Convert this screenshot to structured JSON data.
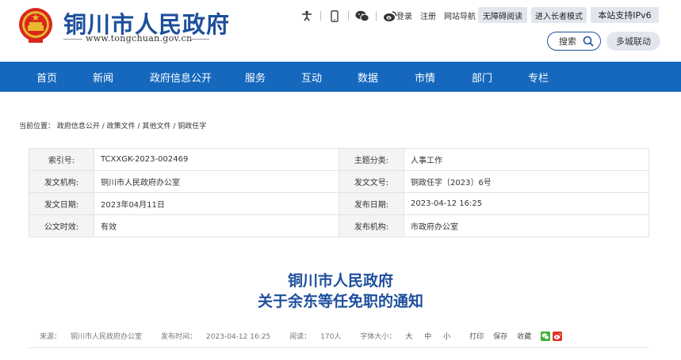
{
  "header": {
    "site_title": "铜川市人民政府",
    "site_url": "www.tongchuan.gov.cn",
    "top_links": {
      "login": "登录",
      "register": "注册",
      "sitemap": "网站导航"
    },
    "accessibility_button": "无障碍阅读",
    "elder_mode_button": "进入长者模式",
    "ipv6_button": "本站支持IPv6",
    "search_label": "搜索",
    "multi_city_button": "多城联动"
  },
  "nav": {
    "items": [
      "首页",
      "新闻",
      "政府信息公开",
      "服务",
      "互动",
      "数据",
      "市情",
      "部门",
      "专栏"
    ]
  },
  "breadcrumb": {
    "prefix": "当前位置：",
    "items": [
      "政府信息公开",
      "政策文件",
      "其他文件",
      "铜政任字"
    ],
    "separator": " / "
  },
  "meta": {
    "rows": [
      {
        "l1": "索引号:",
        "v1": "TCXXGK-2023-002469",
        "l2": "主题分类:",
        "v2": "人事工作"
      },
      {
        "l1": "发文机构:",
        "v1": "铜川市人民政府办公室",
        "l2": "发文文号:",
        "v2": "铜政任字〔2023〕6号"
      },
      {
        "l1": "发文日期:",
        "v1": "2023年04月11日",
        "l2": "发布日期:",
        "v2": "2023-04-12 16:25"
      },
      {
        "l1": "公文时效:",
        "v1": "有效",
        "l2": "发布机构:",
        "v2": "市政府办公室"
      }
    ]
  },
  "document": {
    "title_line1": "铜川市人民政府",
    "title_line2": "关于余东等任免职的通知"
  },
  "info_bar": {
    "source_label": "来源：",
    "source": "铜川市人民政府办公室",
    "time_label": "发布时间：",
    "time": "2023-04-12 16:25",
    "views_label": "阅读：",
    "views": "170人",
    "font_size_label": "字体大小：",
    "font_large": "大",
    "font_medium": "中",
    "font_small": "小",
    "print": "打印",
    "save": "保存",
    "favorite": "收藏"
  },
  "colors": {
    "brand_blue": "#1d4f9c",
    "nav_blue": "#1568bd",
    "valid_green": "#3e9a2f"
  }
}
